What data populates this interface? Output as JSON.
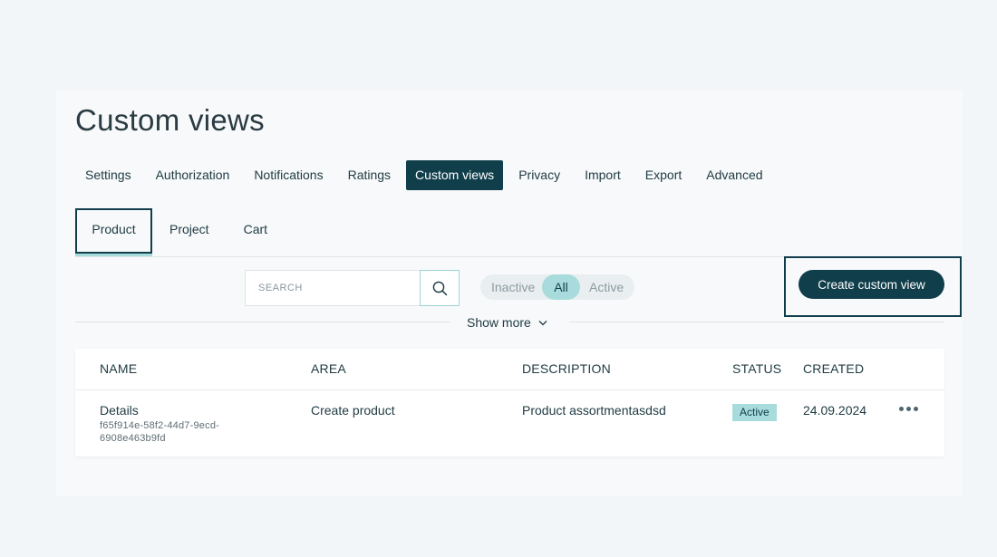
{
  "page": {
    "title": "Custom views"
  },
  "main_tabs": [
    {
      "label": "Settings"
    },
    {
      "label": "Authorization"
    },
    {
      "label": "Notifications"
    },
    {
      "label": "Ratings"
    },
    {
      "label": "Custom views",
      "active": true
    },
    {
      "label": "Privacy"
    },
    {
      "label": "Import"
    },
    {
      "label": "Export"
    },
    {
      "label": "Advanced"
    }
  ],
  "sub_tabs": [
    {
      "label": "Product",
      "active": true
    },
    {
      "label": "Project"
    },
    {
      "label": "Cart"
    }
  ],
  "search": {
    "placeholder": "SEARCH",
    "value": "",
    "icon": "search-icon"
  },
  "status_filter": {
    "options": [
      "Inactive",
      "All",
      "Active"
    ],
    "selected": "All"
  },
  "create_button": {
    "label": "Create custom view"
  },
  "show_more": {
    "label": "Show more",
    "icon": "chevron-down-icon"
  },
  "table": {
    "columns": [
      "NAME",
      "AREA",
      "DESCRIPTION",
      "STATUS",
      "CREATED"
    ],
    "rows": [
      {
        "name": "Details",
        "id": "f65f914e-58f2-44d7-9ecd-6908e463b9fd",
        "area": "Create product",
        "description": "Product assortmentasdsd",
        "status": "Active",
        "created": "24.09.2024",
        "actions_icon": "more-horizontal-icon"
      }
    ]
  },
  "colors": {
    "accent_dark": "#103e4b",
    "accent_light": "#a8dbdb",
    "background": "#f3f6f8",
    "panel": "#f7f9fa"
  }
}
